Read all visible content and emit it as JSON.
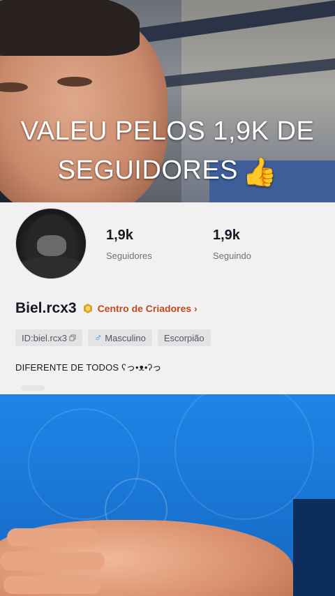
{
  "overlay": {
    "caption_line1": "VALEU PELOS 1,9K DE",
    "caption_line2": "SEGUIDORES",
    "caption_emoji": "👍"
  },
  "profile": {
    "stats": [
      {
        "value": "1,9k",
        "label": "Seguidores"
      },
      {
        "value": "1,9k",
        "label": "Seguindo"
      }
    ],
    "username": "Biel.rcx3",
    "creator_center": "Centro de Criadores",
    "tags": {
      "id": "ID:biel.rcx3",
      "gender": "Masculino",
      "zodiac": "Escorpião"
    },
    "bio": "DIFERENTE DE TODOS ʕっ•ᴥ•ʔっ"
  },
  "colors": {
    "creator_link": "#c2491d",
    "badge": "#d9a520",
    "male_icon": "#2f86d6",
    "card_bg": "#f1f1f2"
  },
  "icons": {
    "badge": "creator-badge-icon",
    "chevron": "chevron-right-icon",
    "copy": "copy-icon",
    "gender": "male-icon"
  }
}
